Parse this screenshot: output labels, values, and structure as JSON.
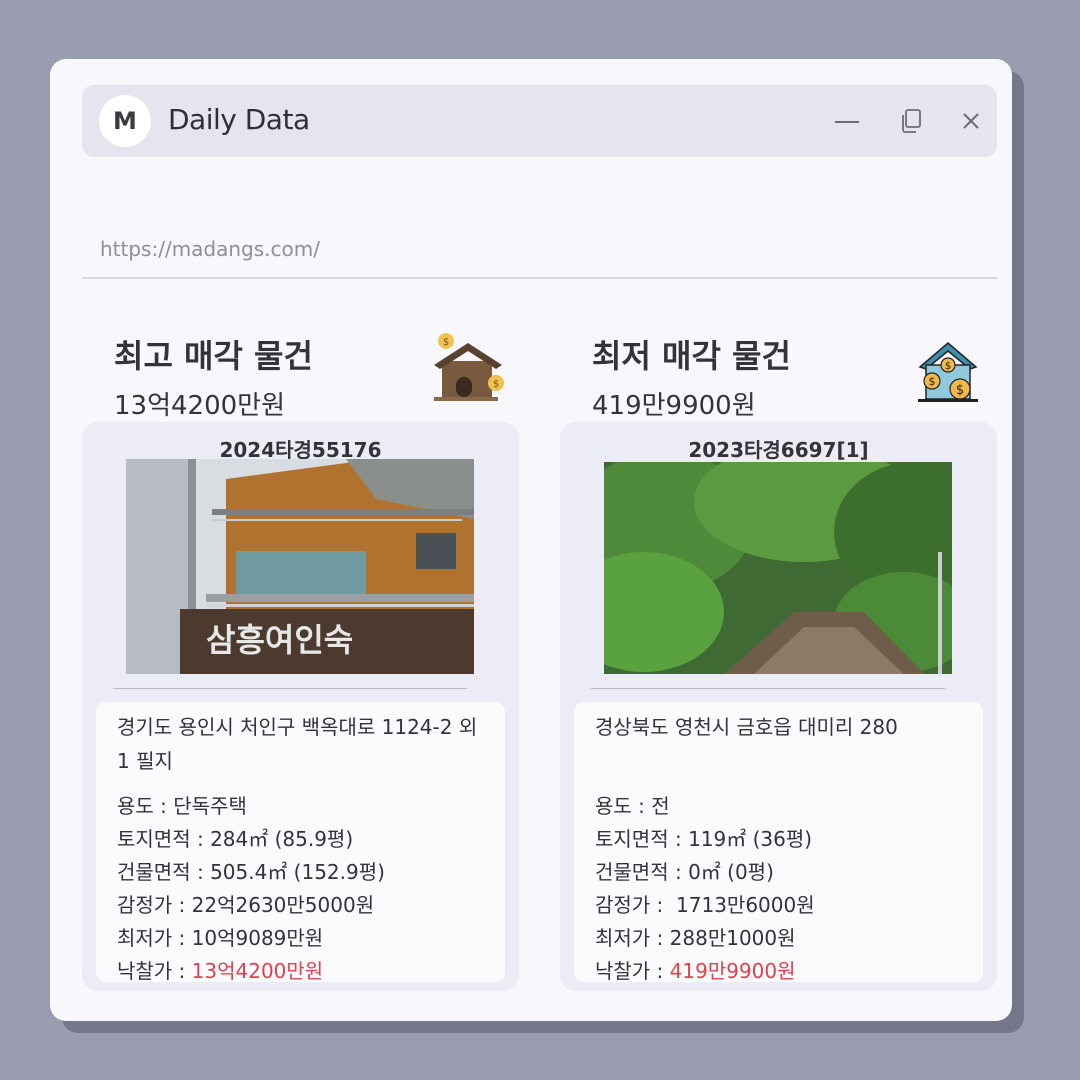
{
  "window": {
    "logo_letter": "M",
    "app_title": "Daily Data",
    "url": "https://madangs.com/"
  },
  "icons": {
    "minimize": "minimize-icon",
    "restore": "restore-icon",
    "close": "close-icon",
    "house_high": "house-with-coins-icon",
    "house_low": "house-with-dollar-coins-icon"
  },
  "colors": {
    "accent_red": "#e1404b",
    "background": "#9a9caf",
    "window": "#f7f7fc",
    "card": "#ebecf6"
  },
  "highest": {
    "title": "최고 매각 물건",
    "price": "13억4200만원",
    "case_no": "2024타경55176",
    "address": "경기도 용인시 처인구 백옥대로 1124-2 외 1 필지",
    "usage_label": "용도 : ",
    "usage": "단독주택",
    "land_label": "토지면적 : ",
    "land": "284㎡ (85.9평)",
    "building_label": "건물면적 : ",
    "building": "505.4㎡ (152.9평)",
    "appraisal_label": "감정가 : ",
    "appraisal": "22억2630만5000원",
    "minimum_label": "최저가 : ",
    "minimum": "10억9089만원",
    "winning_label": "낙찰가 : ",
    "winning": "13억4200만원",
    "photo_sign": "삼흥여인숙"
  },
  "lowest": {
    "title": "최저 매각 물건",
    "price": "419만9900원",
    "case_no": "2023타경6697[1]",
    "address": "경상북도 영천시 금호읍 대미리 280",
    "usage_label": "용도 : ",
    "usage": "전",
    "land_label": "토지면적 : ",
    "land": "119㎡ (36평)",
    "building_label": "건물면적 : ",
    "building": "0㎡ (0평)",
    "appraisal_label": "감정가 :  ",
    "appraisal": "1713만6000원",
    "minimum_label": "최저가 : ",
    "minimum": "288만1000원",
    "winning_label": "낙찰가 : ",
    "winning": "419만9900원"
  }
}
